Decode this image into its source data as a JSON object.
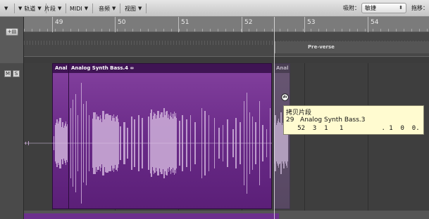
{
  "toolbar": {
    "menus": [
      {
        "label": ""
      },
      {
        "label": "轨道"
      },
      {
        "label": "片段"
      },
      {
        "label": "MIDI"
      },
      {
        "label": "音频"
      },
      {
        "label": "视图"
      }
    ],
    "snap_label": "吸附：",
    "snap_value": "敏捷",
    "drag_label": "拖移："
  },
  "ruler": {
    "bars": [
      "49",
      "50",
      "51",
      "52",
      "53",
      "54"
    ]
  },
  "marker": {
    "label": "Pre-verse"
  },
  "track_header": {
    "mute": "M",
    "solo": "S"
  },
  "regions": [
    {
      "name": "Anal"
    },
    {
      "name": "Analog Synth Bass.4 ∞"
    },
    {
      "name": "Anal"
    }
  ],
  "tooltip": {
    "title": "拷贝片段",
    "line2": "29   Analog Synth Bass.3",
    "line3": "   52  3  1   1          . 1  0  0."
  },
  "icons": {
    "hand_cursor": "hand-cursor-icon",
    "track_icon": "track-icon",
    "link_icon": "link-icon"
  },
  "colors": {
    "region_purple": "#6a2b88",
    "region_head": "#3f1454",
    "waveform": "#c7a6d4",
    "tooltip_bg": "#fffbd0"
  }
}
